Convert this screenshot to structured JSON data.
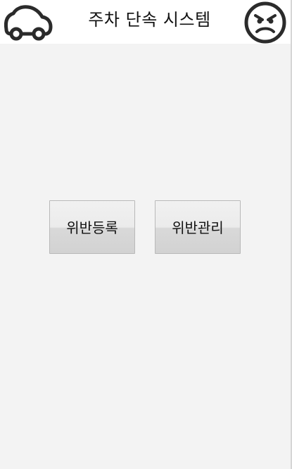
{
  "header": {
    "title": "주차 단속 시스템",
    "left_icon": "car-icon",
    "right_icon": "angry-face-icon"
  },
  "main": {
    "buttons": [
      {
        "label": "위반등록"
      },
      {
        "label": "위반관리"
      }
    ]
  },
  "colors": {
    "header_bg": "#ffffff",
    "content_bg": "#f3f3f3",
    "icon": "#2b2b2b",
    "button_border": "#b9b9b9"
  }
}
